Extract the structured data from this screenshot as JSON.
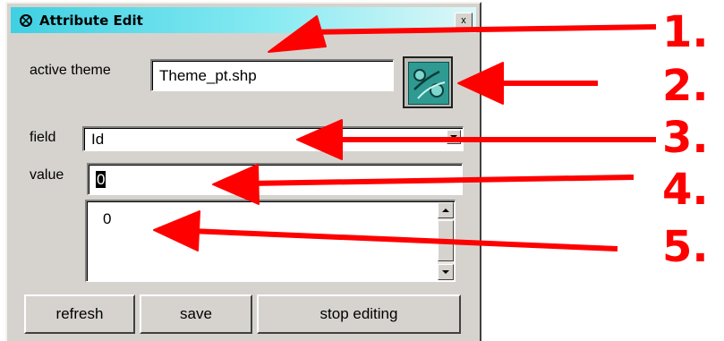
{
  "window": {
    "title": "Attribute Edit",
    "close_label": "x"
  },
  "theme": {
    "label": "active theme",
    "value": "Theme_pt.shp",
    "button_icon": "theme-select-icon"
  },
  "field": {
    "label": "field",
    "value": "Id"
  },
  "value": {
    "label": "value",
    "input_value": "0"
  },
  "list": {
    "items": [
      "0"
    ]
  },
  "buttons": {
    "refresh": "refresh",
    "save": "save",
    "stop_editing": "stop editing"
  },
  "annotations": [
    "1.",
    "2.",
    "3.",
    "4.",
    "5."
  ],
  "colors": {
    "arrow": "#ff0000",
    "titlebar": "#3fd0e2",
    "window_bg": "#d6d3ce"
  }
}
